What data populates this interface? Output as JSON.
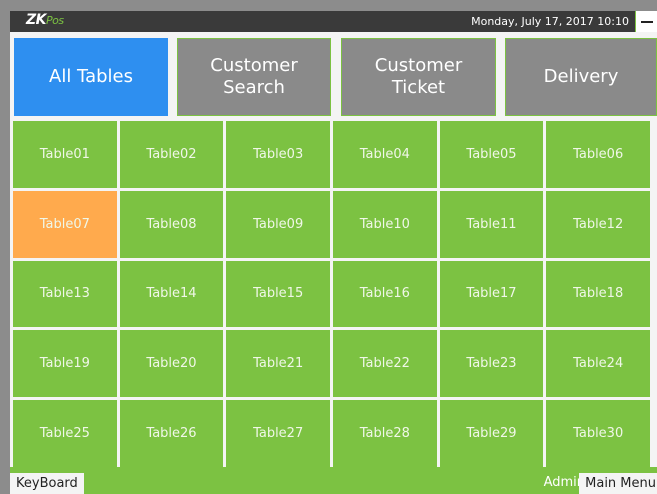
{
  "app": {
    "logo_zk": "ZK",
    "logo_pos": "Pos",
    "datetime": "Monday, July 17, 2017 10:10"
  },
  "tabs": [
    {
      "line1": "All Tables",
      "line2": "",
      "active": true
    },
    {
      "line1": "Customer",
      "line2": "Search",
      "active": false
    },
    {
      "line1": "Customer",
      "line2": "Ticket",
      "active": false
    },
    {
      "line1": "Delivery",
      "line2": "",
      "active": false
    }
  ],
  "tables": [
    "Table01",
    "Table02",
    "Table03",
    "Table04",
    "Table05",
    "Table06",
    "Table07",
    "Table08",
    "Table09",
    "Table10",
    "Table11",
    "Table12",
    "Table13",
    "Table14",
    "Table15",
    "Table16",
    "Table17",
    "Table18",
    "Table19",
    "Table20",
    "Table21",
    "Table22",
    "Table23",
    "Table24",
    "Table25",
    "Table26",
    "Table27",
    "Table28",
    "Table29",
    "Table30"
  ],
  "occupied_tables": [
    "Table07"
  ],
  "footer": {
    "keyboard": "KeyBoard",
    "user": "Admin",
    "main_menu": "Main Menu"
  },
  "colors": {
    "accent_green": "#7cc242",
    "active_blue": "#2e8ff0",
    "occupied_orange": "#ffaa4d",
    "inactive_gray": "#8a8a8a"
  }
}
